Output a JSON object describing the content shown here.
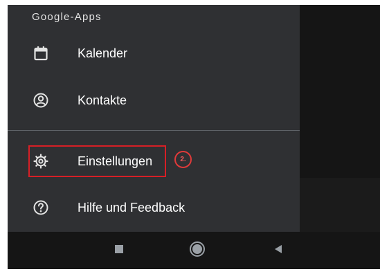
{
  "drawer": {
    "section_header": "Google-Apps",
    "items": [
      {
        "label": "Kalender",
        "icon": "calendar-icon"
      },
      {
        "label": "Kontakte",
        "icon": "contacts-icon"
      },
      {
        "label": "Einstellungen",
        "icon": "settings-gear-icon"
      },
      {
        "label": "Hilfe und Feedback",
        "icon": "help-icon"
      }
    ]
  },
  "annotation": {
    "step_label": "2.",
    "highlight_color": "#d71f26"
  },
  "navbar": {
    "buttons": [
      "recent-apps",
      "home",
      "back"
    ]
  },
  "colors": {
    "drawer_bg": "#2f3033",
    "text": "#ffffff",
    "icon": "#e3e3e3"
  }
}
